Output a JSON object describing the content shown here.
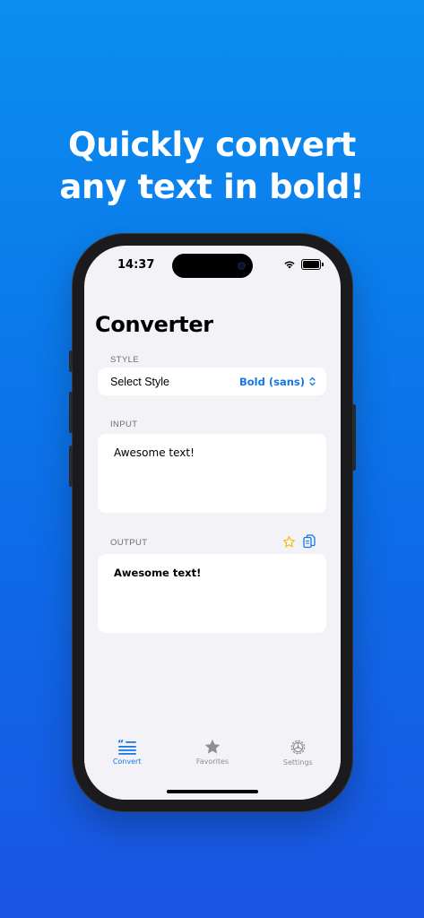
{
  "headline": {
    "line1": "Quickly convert",
    "line2": "any text in bold!"
  },
  "status_bar": {
    "time": "14:37"
  },
  "screen": {
    "title": "Converter",
    "style_section": {
      "label": "STYLE",
      "row_label": "Select Style",
      "selected_value": "Bold (sans)"
    },
    "input_section": {
      "label": "INPUT",
      "text": "Awesome text!"
    },
    "output_section": {
      "label": "OUTPUT",
      "text": "Awesome text!"
    }
  },
  "tab_bar": {
    "tabs": [
      {
        "label": "Convert",
        "icon": "quote-list-icon",
        "active": true
      },
      {
        "label": "Favorites",
        "icon": "star-icon",
        "active": false
      },
      {
        "label": "Settings",
        "icon": "gear-icon",
        "active": false
      }
    ]
  },
  "colors": {
    "accent": "#1577e6",
    "favorite": "#f5b800",
    "background_top": "#0a8ef0",
    "background_bottom": "#1a55e3"
  }
}
